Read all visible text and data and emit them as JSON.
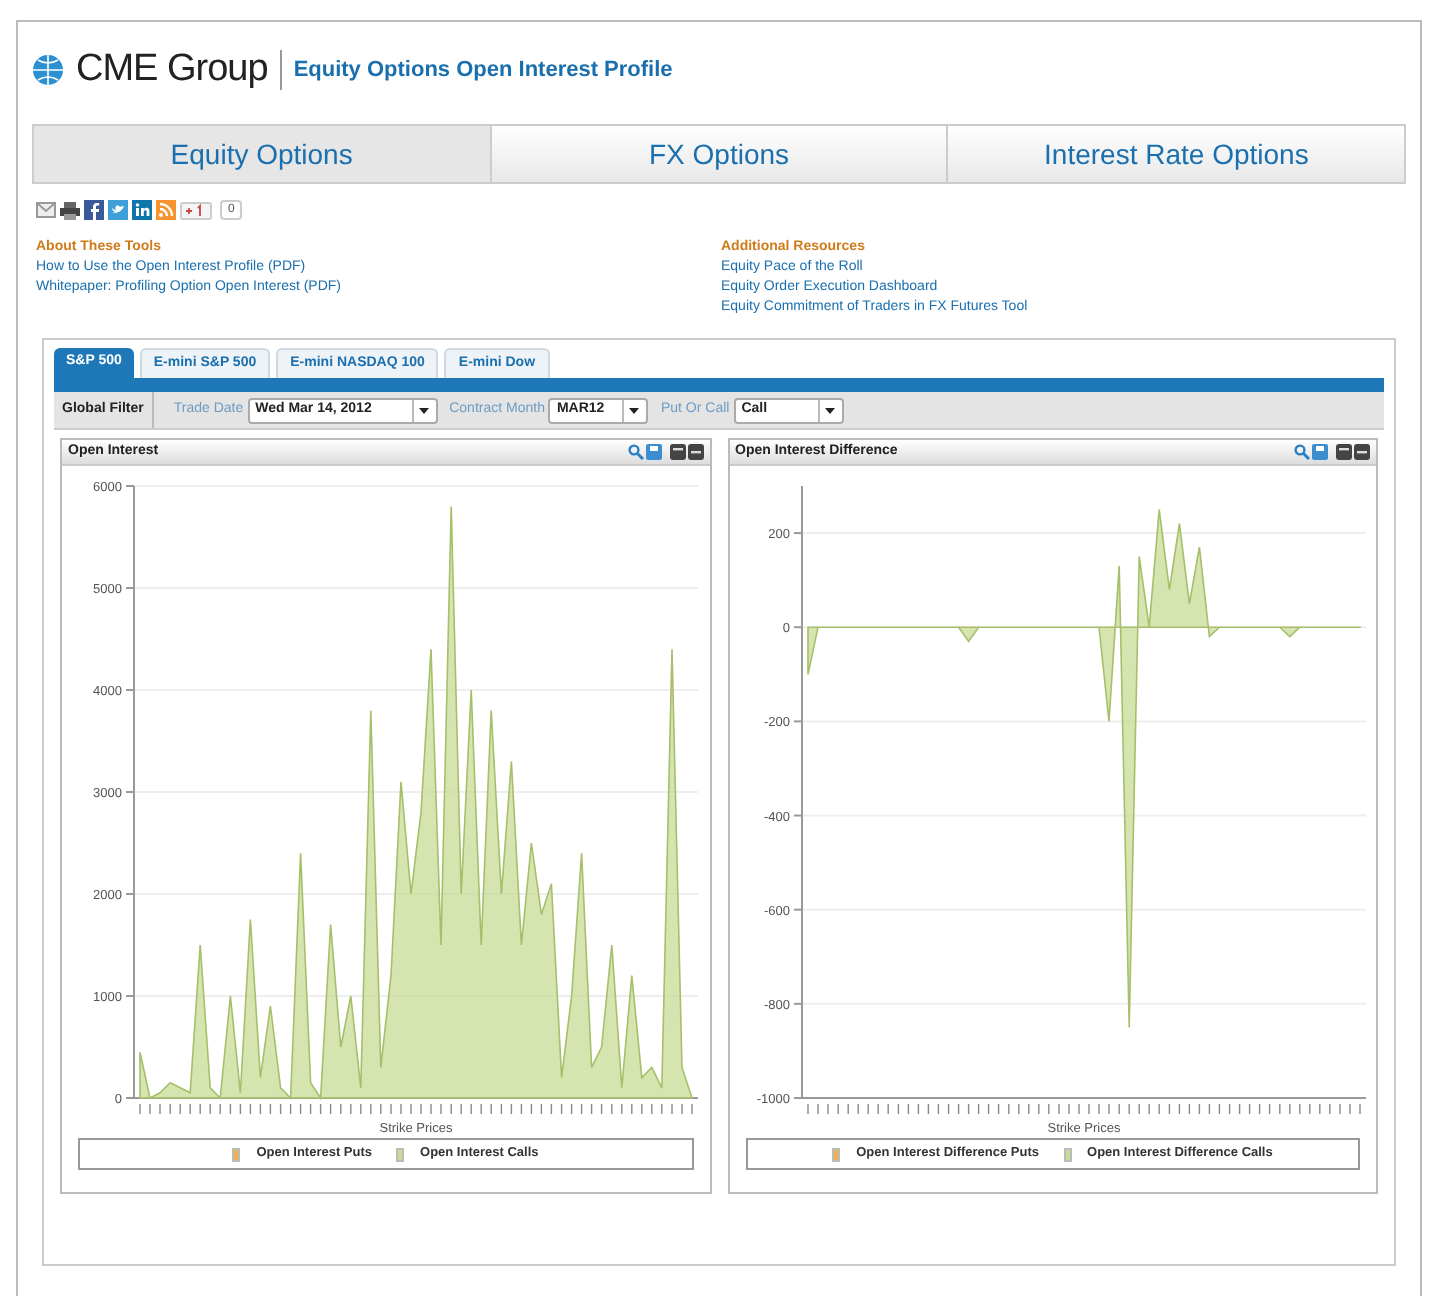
{
  "header": {
    "brand": "CME Group",
    "title": "Equity Options Open Interest Profile"
  },
  "main_tabs": [
    {
      "label": "Equity Options",
      "selected": true
    },
    {
      "label": "FX Options",
      "selected": false
    },
    {
      "label": "Interest Rate Options",
      "selected": false
    }
  ],
  "share_count": "0",
  "resources": [
    {
      "heading": "About These Tools",
      "links": [
        "How to Use the Open Interest Profile (PDF)",
        "Whitepaper: Profiling Option Open Interest (PDF)"
      ]
    },
    {
      "heading": "Additional Resources",
      "links": [
        "Equity Pace of the Roll",
        "Equity Order Execution Dashboard",
        "Equity Commitment of Traders in FX Futures Tool"
      ]
    }
  ],
  "product_tabs": [
    {
      "label": "S&P 500",
      "selected": true
    },
    {
      "label": "E-mini S&P 500",
      "selected": false
    },
    {
      "label": "E-mini NASDAQ 100",
      "selected": false
    },
    {
      "label": "E-mini Dow",
      "selected": false
    }
  ],
  "filter": {
    "label": "Global Filter",
    "fields": [
      {
        "label": "Trade Date",
        "value": "Wed Mar 14, 2012"
      },
      {
        "label": "Contract Month",
        "value": "MAR12"
      },
      {
        "label": "Put Or Call",
        "value": "Call"
      }
    ]
  },
  "panels": [
    {
      "title": "Open Interest",
      "legend": [
        {
          "label": "Open Interest Puts",
          "color": "#f0b050"
        },
        {
          "label": "Open Interest Calls",
          "color": "#c8dc96"
        }
      ],
      "chart_data": {
        "type": "area",
        "grid": true,
        "xlabel": "Strike Prices",
        "ylim": [
          0,
          6000
        ],
        "yticks": [
          0,
          1000,
          2000,
          3000,
          4000,
          5000,
          6000
        ],
        "series": [
          {
            "color": "#c8dc96",
            "values": [
              450,
              0,
              50,
              150,
              100,
              50,
              1500,
              100,
              0,
              1000,
              50,
              1750,
              200,
              900,
              100,
              0,
              2400,
              150,
              0,
              1700,
              500,
              1000,
              100,
              3800,
              300,
              1200,
              3100,
              2000,
              2800,
              4400,
              1500,
              5800,
              2000,
              4000,
              1500,
              3800,
              2000,
              3300,
              1500,
              2500,
              1800,
              2100,
              200,
              1000,
              2400,
              300,
              500,
              1500,
              100,
              1200,
              200,
              300,
              100,
              4400,
              300,
              0
            ]
          }
        ]
      }
    },
    {
      "title": "Open Interest Difference",
      "legend": [
        {
          "label": "Open Interest Difference Puts",
          "color": "#f0b050"
        },
        {
          "label": "Open Interest Difference Calls",
          "color": "#c8dc96"
        }
      ],
      "chart_data": {
        "type": "area",
        "grid": true,
        "xlabel": "Strike Prices",
        "ylim": [
          -1000,
          300
        ],
        "yticks": [
          -1000,
          -800,
          -600,
          -400,
          -200,
          0,
          200
        ],
        "series": [
          {
            "color": "#c8dc96",
            "values": [
              -100,
              0,
              0,
              0,
              0,
              0,
              0,
              0,
              0,
              0,
              0,
              0,
              0,
              0,
              0,
              0,
              -30,
              0,
              0,
              0,
              0,
              0,
              0,
              0,
              0,
              0,
              0,
              0,
              0,
              0,
              -200,
              130,
              -850,
              150,
              0,
              250,
              80,
              220,
              50,
              170,
              -20,
              0,
              0,
              0,
              0,
              0,
              0,
              0,
              -20,
              0,
              0,
              0,
              0,
              0,
              0,
              0
            ]
          }
        ]
      }
    }
  ]
}
